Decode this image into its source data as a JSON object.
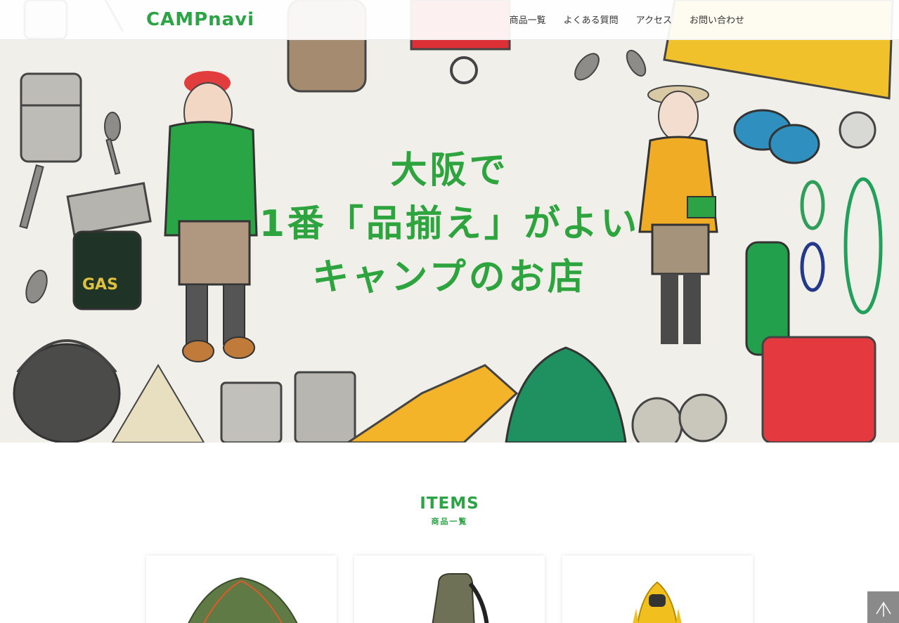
{
  "header": {
    "logo": "CAMPnavi",
    "nav": [
      "商品一覧",
      "よくある質問",
      "アクセス",
      "お問い合わせ"
    ]
  },
  "hero": {
    "lines": [
      "大阪で",
      "1番「品揃え」がよい",
      "キャンプのお店"
    ],
    "illustration_labels": {
      "gas_can": "GAS"
    }
  },
  "items": {
    "title_en": "ITEMS",
    "title_ja": "商品一覧",
    "cards": [
      {
        "icon": "tent-icon"
      },
      {
        "icon": "backpack-icon"
      },
      {
        "icon": "jacket-icon"
      }
    ]
  },
  "back_to_top": {
    "icon": "arrow-up-icon"
  },
  "colors": {
    "brand_green": "#2ca445",
    "hero_bg": "#f1efe9"
  }
}
